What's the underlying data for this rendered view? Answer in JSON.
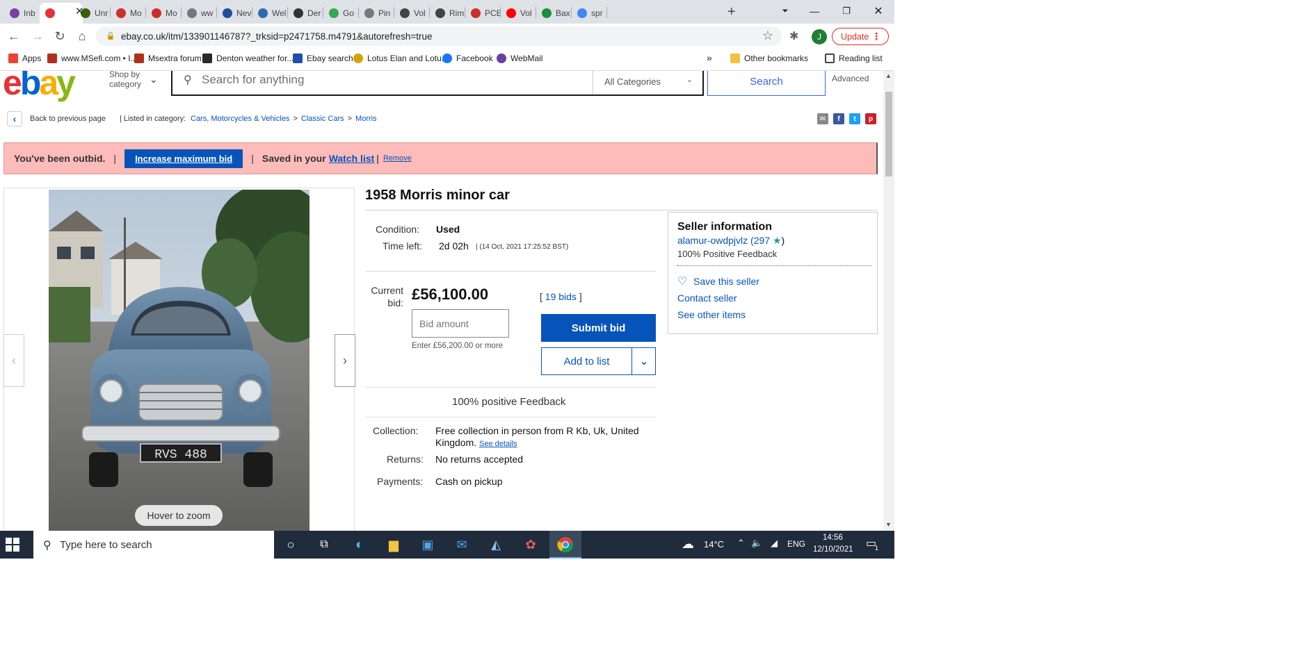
{
  "browser": {
    "tabs": [
      {
        "label": "Inb",
        "color": "#7b3fa0"
      },
      {
        "label": "",
        "color": "#e53238",
        "active": true
      },
      {
        "label": "Unr",
        "color": "#3a5f0b"
      },
      {
        "label": "Mo",
        "color": "#c9302c"
      },
      {
        "label": "Mo",
        "color": "#c9302c"
      },
      {
        "label": "ww",
        "color": "#777777"
      },
      {
        "label": "Nev",
        "color": "#1f4f99"
      },
      {
        "label": "Wel",
        "color": "#2b6cb0"
      },
      {
        "label": "Der",
        "color": "#333333"
      },
      {
        "label": "Go",
        "color": "#34a853"
      },
      {
        "label": "Pin",
        "color": "#777777"
      },
      {
        "label": "Vol",
        "color": "#444444"
      },
      {
        "label": "Rim",
        "color": "#444444"
      },
      {
        "label": "PCE",
        "color": "#c9302c"
      },
      {
        "label": "Vol",
        "color": "#ff0000"
      },
      {
        "label": "Bax",
        "color": "#1e8e3e"
      },
      {
        "label": "spr",
        "color": "#4285f4"
      }
    ],
    "url": "ebay.co.uk/itm/133901146787?_trksid=p2471758.m4791&autorefresh=true",
    "profile_initial": "J",
    "update_label": "Update",
    "bookmarks": [
      {
        "label": "Apps",
        "color": "#ea4335"
      },
      {
        "label": "www.MSefi.com • I...",
        "color": "#b03020"
      },
      {
        "label": "Msextra forum",
        "color": "#b03020"
      },
      {
        "label": "Denton weather for...",
        "color": "#2a2a2a"
      },
      {
        "label": "Ebay search",
        "color": "#1f4fa8"
      },
      {
        "label": "Lotus Elan and Lotu...",
        "color": "#d4a400"
      },
      {
        "label": "Facebook",
        "color": "#1877f2"
      },
      {
        "label": "WebMail",
        "color": "#6b3fa0"
      }
    ],
    "bookmarks_more": "»",
    "other_bookmarks": "Other bookmarks",
    "reading_list": "Reading list"
  },
  "ebay": {
    "logo": {
      "e": "e",
      "b": "b",
      "a": "a",
      "y": "y"
    },
    "shop_by_category": "Shop by category",
    "search_placeholder": "Search for anything",
    "category": "All Categories",
    "search_button": "Search",
    "advanced": "Advanced",
    "back": "Back to previous page",
    "listed_in": "| Listed in category:",
    "breadcrumb": [
      "Cars, Motorcycles & Vehicles",
      "Classic Cars",
      "Morris"
    ],
    "breadcrumb_sep": ">",
    "banner": {
      "outbid": "You've been outbid.",
      "pipe": "|",
      "increase": "Increase maximum bid",
      "saved": "Saved in your",
      "watch_list": "Watch list",
      "remove": "Remove"
    },
    "image": {
      "hover_zoom": "Hover to zoom",
      "plate": "RVS 488"
    },
    "title": "1958 Morris minor car",
    "condition_label": "Condition:",
    "condition": "Used",
    "time_left_label": "Time left:",
    "time_left": "2d 02h",
    "time_extra": "| (14 Oct, 2021   17:25:52 BST)",
    "current_bid_label": "Current bid:",
    "current_bid": "£56,100.00",
    "bids_open": "[",
    "bids": "19 bids",
    "bids_close": "]",
    "bid_placeholder": "Bid amount",
    "bid_hint": "Enter £56,200.00 or more",
    "submit": "Submit bid",
    "add_to_list": "Add to list",
    "positive_feedback": "100% positive Feedback",
    "collection_label": "Collection:",
    "collection": "Free collection in person from R Kb, Uk, United Kingdom.",
    "see_details": "See details",
    "returns_label": "Returns:",
    "returns": "No returns accepted",
    "payments_label": "Payments:",
    "payments": "Cash on pickup",
    "seller": {
      "title": "Seller information",
      "name": "alamur-owdpjvlz",
      "score": "(297",
      "score_close": ")",
      "feedback": "100% Positive Feedback",
      "save": "Save this seller",
      "contact": "Contact seller",
      "other": "See other items"
    }
  },
  "taskbar": {
    "search_placeholder": "Type here to search",
    "temp": "14°C",
    "lang": "ENG",
    "time": "14:56",
    "date": "12/10/2021",
    "notifications": "1"
  }
}
